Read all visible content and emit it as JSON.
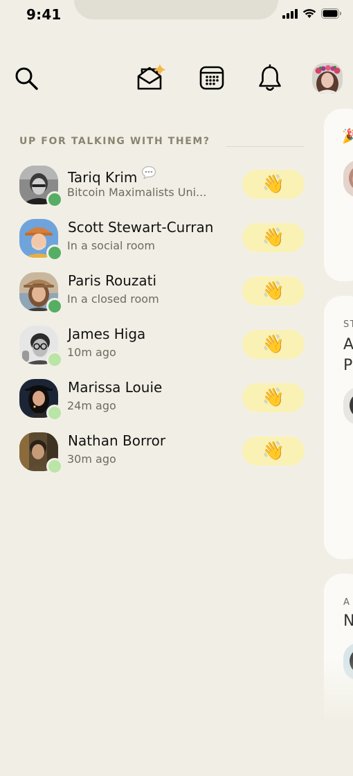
{
  "status_bar": {
    "time": "9:41"
  },
  "nav": {
    "icons": [
      "search-icon",
      "envelope-sparkle-icon",
      "calendar-icon",
      "bell-icon",
      "profile-avatar"
    ]
  },
  "section": {
    "title": "UP FOR TALKING WITH THEM?"
  },
  "contacts": [
    {
      "name": "Tariq Krim",
      "status": "Bitcoin Maximalists Uni...",
      "presence": "online",
      "has_message": true,
      "wave": "👋"
    },
    {
      "name": "Scott Stewart-Curran",
      "status": "In a social room",
      "presence": "online",
      "has_message": false,
      "wave": "👋"
    },
    {
      "name": "Paris Rouzati",
      "status": "In a closed room",
      "presence": "online",
      "has_message": false,
      "wave": "👋"
    },
    {
      "name": "James Higa",
      "status": "10m ago",
      "presence": "away",
      "has_message": false,
      "wave": "👋"
    },
    {
      "name": "Marissa Louie",
      "status": "24m ago",
      "presence": "away",
      "has_message": false,
      "wave": "👋"
    },
    {
      "name": "Nathan Borror",
      "status": "30m ago",
      "presence": "away",
      "has_message": false,
      "wave": "👋"
    }
  ],
  "cards": [
    {
      "emoji": "🎉",
      "label": "",
      "title": ""
    },
    {
      "emoji": "",
      "label": "ST",
      "title": "A",
      "title2": "P"
    },
    {
      "emoji": "",
      "label": "A",
      "title": "N"
    }
  ],
  "colors": {
    "background": "#f1efe5",
    "online": "#55ae64",
    "away": "#b9e5a6",
    "wave_button": "#faf1b5",
    "section_header": "#8a8470"
  }
}
